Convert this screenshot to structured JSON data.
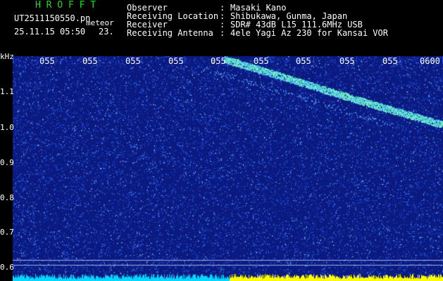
{
  "header": {
    "app_name": "H R O F F T",
    "file_name": "UT2511150550.pn",
    "tag": "meteor",
    "datetime": "25.11.15 05:50",
    "number": "23.",
    "fields": [
      {
        "label": "Observer",
        "sep": ":",
        "value": "Masaki Kano"
      },
      {
        "label": "Receiving Location",
        "sep": ":",
        "value": "Shibukawa, Gunma, Japan"
      },
      {
        "label": "Receiver",
        "sep": ":",
        "value": "SDR# 43dB L15 111.6MHz USB"
      },
      {
        "label": "Receiving Antenna",
        "sep": ":",
        "value": "4ele Yagi Az 230 for Kansai VOR"
      }
    ]
  },
  "spectrogram": {
    "y_unit": "kHz",
    "y_ticks": [
      "1.1",
      "1.0",
      "0.9",
      "0.8",
      "0.7",
      "0.6"
    ],
    "x_ticks": [
      "055",
      "055",
      "055",
      "055",
      "055",
      "055",
      "055",
      "055",
      "055",
      "0600"
    ],
    "colors": {
      "background": "#0b1a80",
      "noise": "#3c7cff",
      "trace": "#7fffc0",
      "bar_left": "#00d8ff",
      "bar_right": "#ffff00"
    }
  }
}
